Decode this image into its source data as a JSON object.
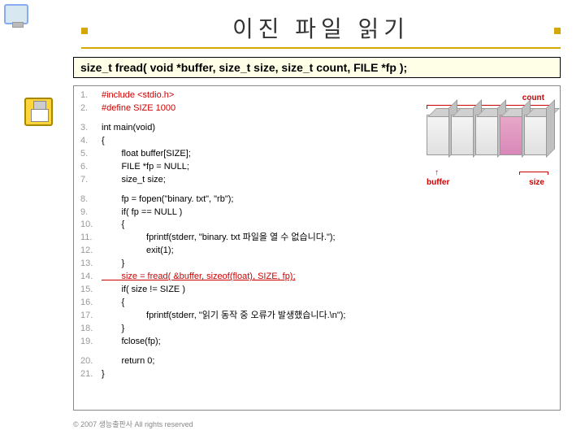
{
  "title": "이진 파일 읽기",
  "signature": "size_t fread( void *buffer, size_t size, size_t count, FILE *fp );",
  "diagram": {
    "count": "count",
    "buffer": "buffer",
    "size": "size"
  },
  "code": {
    "l1": "#include <stdio.h>",
    "l2": "#define SIZE 1000",
    "l3": "int main(void)",
    "l4": "{",
    "l5": "        float buffer[SIZE];",
    "l6": "        FILE *fp = NULL;",
    "l7": "        size_t size;",
    "l8": "        fp = fopen(\"binary. txt\", \"rb\");",
    "l9": "        if( fp == NULL )",
    "l10": "        {",
    "l11": "                  fprintf(stderr, \"binary. txt 파일을 열 수 없습니다.\");",
    "l12": "                  exit(1);",
    "l13": "        }",
    "l14": "        size = fread( &buffer, sizeof(float), SIZE, fp);",
    "l15": "        if( size != SIZE )",
    "l16": "        {",
    "l17": "                  fprintf(stderr, \"읽기 동작 중 오류가 발생했습니다.\\n\");",
    "l18": "        }",
    "l19": "        fclose(fp);",
    "l20": "        return 0;",
    "l21": "}"
  },
  "footer": "© 2007 생능출판사  All rights reserved"
}
